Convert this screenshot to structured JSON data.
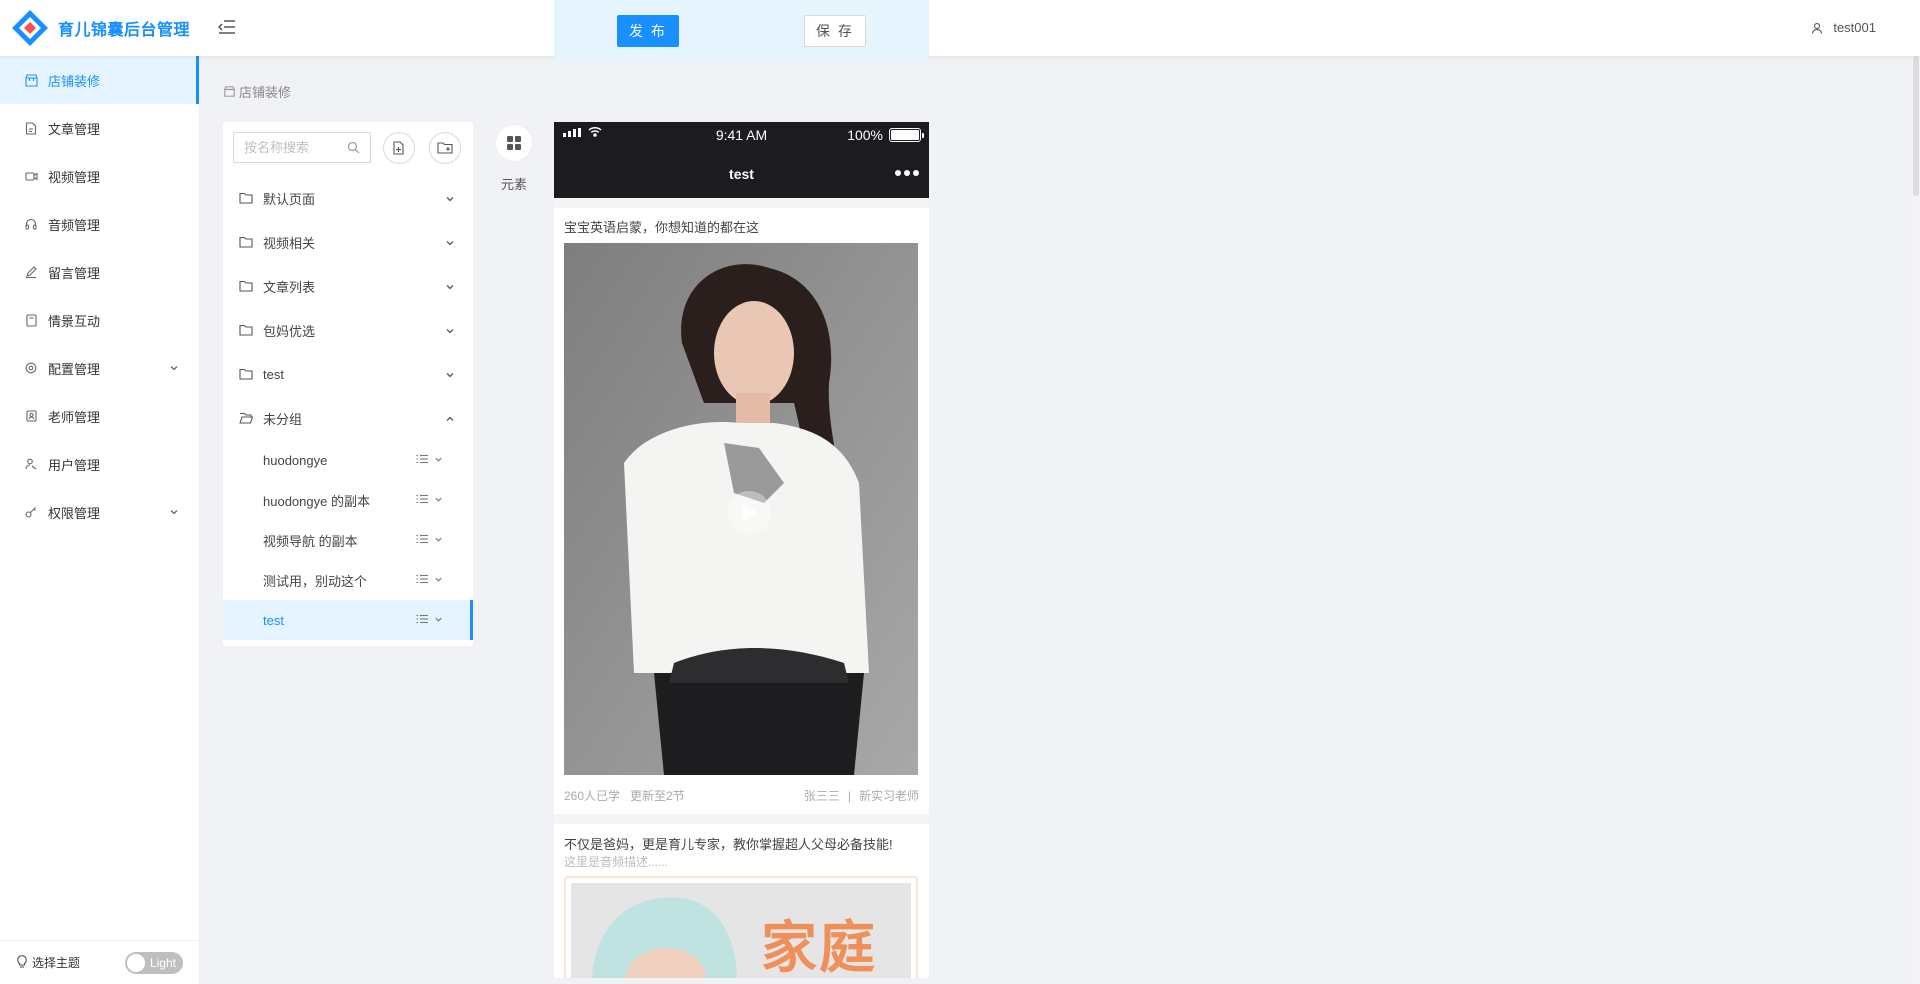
{
  "app": {
    "title": "育儿锦囊后台管理",
    "brand_color": "#1890ff"
  },
  "header": {
    "publish_label": "发 布",
    "save_label": "保 存",
    "username": "test001"
  },
  "sidebar": {
    "items": [
      {
        "label": "店铺装修",
        "icon": "shop-icon",
        "active": true
      },
      {
        "label": "文章管理",
        "icon": "document-icon"
      },
      {
        "label": "视频管理",
        "icon": "video-icon"
      },
      {
        "label": "音频管理",
        "icon": "headphones-icon"
      },
      {
        "label": "留言管理",
        "icon": "edit-icon"
      },
      {
        "label": "情景互动",
        "icon": "book-icon"
      },
      {
        "label": "配置管理",
        "icon": "settings-icon",
        "has_children": true
      },
      {
        "label": "老师管理",
        "icon": "contacts-icon"
      },
      {
        "label": "用户管理",
        "icon": "user-icon"
      },
      {
        "label": "权限管理",
        "icon": "key-icon",
        "has_children": true
      }
    ],
    "theme_label": "选择主题",
    "theme_toggle": "Light"
  },
  "breadcrumb": {
    "label": "店铺装修"
  },
  "tree": {
    "search_placeholder": "按名称搜索",
    "groups": [
      {
        "label": "默认页面",
        "expanded": false
      },
      {
        "label": "视频相关",
        "expanded": false
      },
      {
        "label": "文章列表",
        "expanded": false
      },
      {
        "label": "包妈优选",
        "expanded": false
      },
      {
        "label": "test",
        "expanded": false
      },
      {
        "label": "未分组",
        "expanded": true
      }
    ],
    "pages": [
      {
        "label": "huodongye"
      },
      {
        "label": "huodongye 的副本"
      },
      {
        "label": "视频导航 的副本"
      },
      {
        "label": "测试用，别动这个"
      },
      {
        "label": "test",
        "selected": true
      }
    ]
  },
  "element_tool": {
    "label": "元素"
  },
  "phone": {
    "time": "9:41 AM",
    "battery": "100%",
    "title": "test",
    "card1": {
      "title": "宝宝英语启蒙，你想知道的都在这",
      "learners": "260人已学",
      "update": "更新至2节",
      "teacher": "张三三",
      "teacher_title": "新实习老师"
    },
    "card2": {
      "title": "不仅是爸妈，更是育儿专家，教你掌握超人父母必备技能!",
      "desc": "这里是音频描述......",
      "banner_word": "家庭"
    }
  }
}
